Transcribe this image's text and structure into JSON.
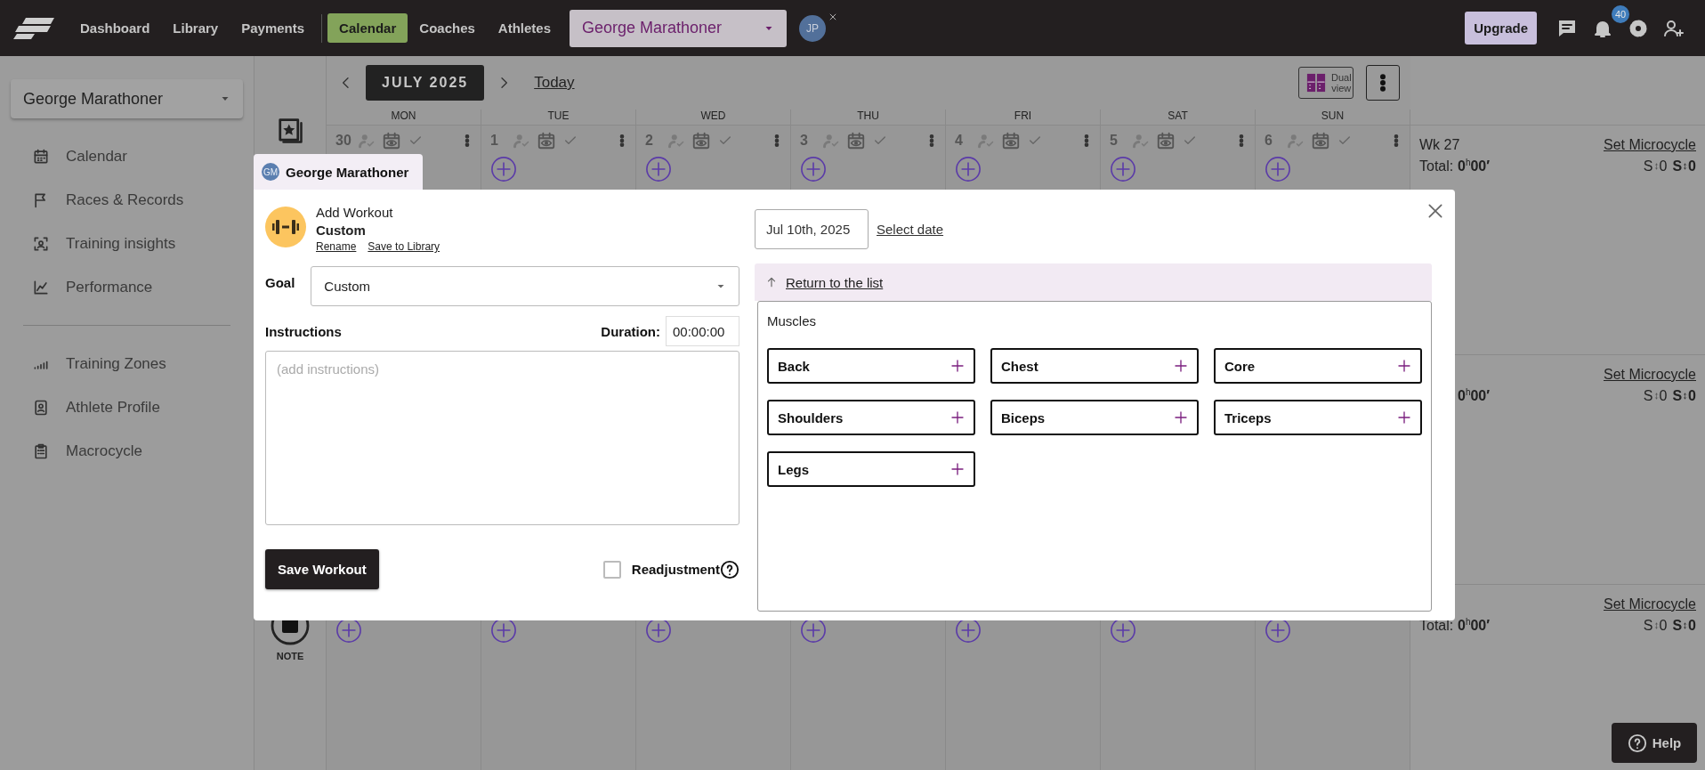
{
  "top_nav": {
    "primary_links": [
      {
        "label": "Dashboard",
        "selected": false
      },
      {
        "label": "Library",
        "selected": false
      },
      {
        "label": "Payments",
        "selected": false
      }
    ],
    "secondary_links": [
      {
        "label": "Calendar",
        "selected": true
      },
      {
        "label": "Coaches",
        "selected": false
      },
      {
        "label": "Athletes",
        "selected": false
      }
    ],
    "athlete_select": {
      "value": "George Marathoner"
    },
    "avatar": {
      "initials": "JP"
    },
    "upgrade_button": "Upgrade",
    "notification_count": "40"
  },
  "sidebar": {
    "athlete_select": {
      "value": "George Marathoner"
    },
    "sections": [
      [
        {
          "label": "Calendar"
        },
        {
          "label": "Races & Records"
        },
        {
          "label": "Training insights"
        },
        {
          "label": "Performance"
        }
      ],
      [
        {
          "label": "Training Zones"
        },
        {
          "label": "Athlete Profile"
        },
        {
          "label": "Macrocycle"
        }
      ]
    ]
  },
  "calendar": {
    "month": "JULY 2025",
    "today_link": "Today",
    "dual_view_button": "Dual view",
    "weekdays": [
      "MON",
      "TUE",
      "WED",
      "THU",
      "FRI",
      "SAT",
      "SUN"
    ]
  },
  "weeks": [
    {
      "day_numbers": [
        "30",
        "1",
        "2",
        "3",
        "4",
        "5",
        "6"
      ],
      "add_buttons": [
        false,
        true,
        true,
        true,
        true,
        true,
        true
      ],
      "week_label": "Wk 27",
      "microcycle_link": "Set Microcycle",
      "total_label": "Total:",
      "total": "0$^{h}$00′",
      "stats": [
        {
          "letter": "S",
          "value": "0",
          "kind": "plain"
        },
        {
          "letter": "S",
          "value": "0",
          "kind": "strong"
        }
      ]
    },
    {
      "microcycle_link": "Set Microcycle",
      "total": "0$^{h}$00′",
      "stats": [
        {
          "letter": "S",
          "value": "0",
          "kind": "plain"
        },
        {
          "letter": "S",
          "value": "0",
          "kind": "strong"
        }
      ]
    },
    {
      "side_label": "NOTE",
      "add_buttons": [
        true,
        true,
        true,
        true,
        true,
        true,
        true
      ],
      "microcycle_link": "Set Microcycle",
      "total_label": "Total:",
      "total": "0$^{h}$00′",
      "stats": [
        {
          "letter": "S",
          "value": "0",
          "kind": "plain"
        },
        {
          "letter": "S",
          "value": "0",
          "kind": "strong"
        }
      ]
    }
  ],
  "modal": {
    "tab": {
      "initials": "GM",
      "name": "George Marathoner"
    },
    "header": {
      "title": "Add Workout",
      "name": "Custom",
      "links": [
        "Rename",
        "Save to Library"
      ]
    },
    "goal": {
      "label": "Goal",
      "value": "Custom"
    },
    "instructions": {
      "label": "Instructions",
      "placeholder": "(add instructions)"
    },
    "duration": {
      "label": "Duration:",
      "value": "00:00:00"
    },
    "save_button": "Save Workout",
    "readjustment": {
      "label": "Readjustment",
      "checked": false
    },
    "date": {
      "value": "Jul 10th, 2025"
    },
    "select_date_link": "Select date",
    "return_link": "Return to the list",
    "muscles": {
      "title": "Muscles",
      "items": [
        "Back",
        "Chest",
        "Core",
        "Shoulders",
        "Biceps",
        "Triceps",
        "Legs"
      ]
    }
  },
  "help_button": "Help"
}
